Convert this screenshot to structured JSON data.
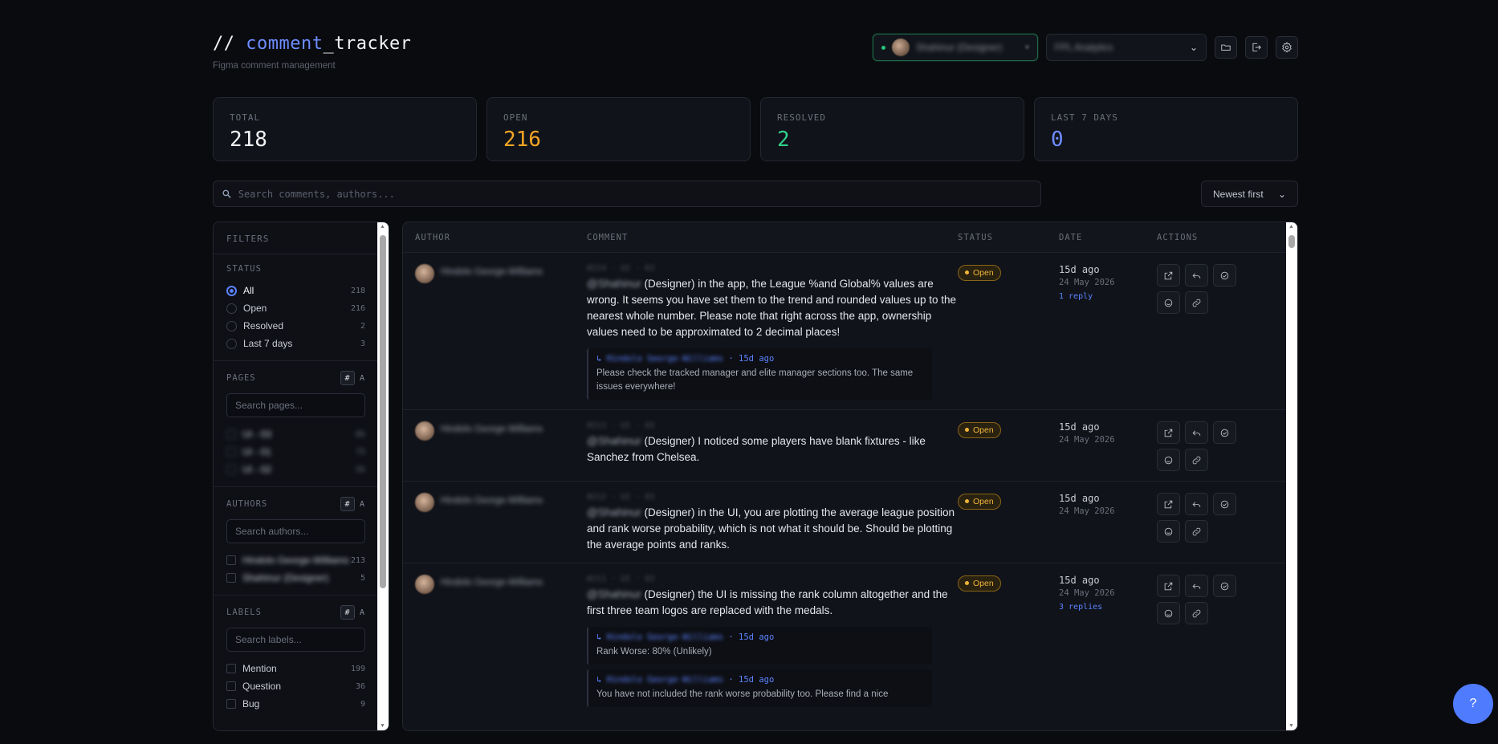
{
  "brand": {
    "prefix": "// ",
    "accent": "comment",
    "suffix": "_tracker",
    "subtitle": "Figma comment management"
  },
  "header": {
    "user_name": "Shahinur (Designer)",
    "project": "FPL Analytics"
  },
  "stats": [
    {
      "label": "TOTAL",
      "value": "218",
      "color": "#f2f3f5"
    },
    {
      "label": "OPEN",
      "value": "216",
      "color": "#f5a524"
    },
    {
      "label": "RESOLVED",
      "value": "2",
      "color": "#2fd18a"
    },
    {
      "label": "LAST 7 DAYS",
      "value": "0",
      "color": "#6e8dff"
    }
  ],
  "search": {
    "placeholder": "Search comments, authors..."
  },
  "sort": {
    "value": "Newest first"
  },
  "filters": {
    "title": "FILTERS",
    "status_title": "STATUS",
    "status": [
      {
        "label": "All",
        "count": "218"
      },
      {
        "label": "Open",
        "count": "216"
      },
      {
        "label": "Resolved",
        "count": "2"
      },
      {
        "label": "Last 7 days",
        "count": "3"
      }
    ],
    "pages_title": "PAGES",
    "pages_placeholder": "Search pages...",
    "pages": [
      {
        "label": "UI - 03",
        "count": "86"
      },
      {
        "label": "UI - 01",
        "count": "75"
      },
      {
        "label": "UI - 02",
        "count": "56"
      }
    ],
    "authors_title": "AUTHORS",
    "authors_placeholder": "Search authors...",
    "authors": [
      {
        "label": "Hindolo George-Williams",
        "count": "213"
      },
      {
        "label": "Shahinur (Designer)",
        "count": "5"
      }
    ],
    "labels_title": "LABELS",
    "labels_placeholder": "Search labels...",
    "labels": [
      {
        "label": "Mention",
        "count": "199"
      },
      {
        "label": "Question",
        "count": "36"
      },
      {
        "label": "Bug",
        "count": "9"
      }
    ],
    "toggle_hash": "#",
    "toggle_a": "A"
  },
  "table": {
    "headers": {
      "author": "AUTHOR",
      "comment": "COMMENT",
      "status": "STATUS",
      "date": "DATE",
      "actions": "ACTIONS"
    },
    "rows": [
      {
        "author": "Hindolo George-Williams",
        "meta": "#214 · UI · 03",
        "mention": "@Shahinur",
        "text": " (Designer) in the app, the League %and Global% values are wrong. It seems you have set them to the trend and rounded values up to the nearest whole number. Please note that right across the app, ownership values need to be approximated to 2 decimal places!",
        "status": "Open",
        "date_rel": "15d ago",
        "date_abs": "24 May 2026",
        "replies_label": "1 reply",
        "replies": [
          {
            "author": "Hindolo George-Williams",
            "time": "15d ago",
            "text": "Please check the tracked manager and elite manager sections too. The same issues everywhere!"
          }
        ]
      },
      {
        "author": "Hindolo George-Williams",
        "meta": "#213 · UI · 03",
        "mention": "@Shahinur",
        "text": " (Designer) I noticed some players have blank fixtures - like Sanchez from Chelsea.",
        "status": "Open",
        "date_rel": "15d ago",
        "date_abs": "24 May 2026",
        "replies_label": "",
        "replies": []
      },
      {
        "author": "Hindolo George-Williams",
        "meta": "#212 · UI · 03",
        "mention": "@Shahinur",
        "text": " (Designer) in the UI, you are plotting the average league position and rank worse probability, which is not what it should be. Should be plotting the average points and ranks.",
        "status": "Open",
        "date_rel": "15d ago",
        "date_abs": "24 May 2026",
        "replies_label": "",
        "replies": []
      },
      {
        "author": "Hindolo George-Williams",
        "meta": "#211 · UI · 03",
        "mention": "@Shahinur",
        "text": " (Designer) the UI is missing the rank column altogether and the first three team logos are replaced with the medals.",
        "status": "Open",
        "date_rel": "15d ago",
        "date_abs": "24 May 2026",
        "replies_label": "3 replies",
        "replies": [
          {
            "author": "Hindolo George-Williams",
            "time": "15d ago",
            "text": "Rank Worse: 80% (Unlikely)"
          },
          {
            "author": "Hindolo George-Williams",
            "time": "15d ago",
            "text": "You have not included the rank worse probability too. Please find a nice"
          }
        ]
      }
    ]
  },
  "help": {
    "label": "?"
  }
}
